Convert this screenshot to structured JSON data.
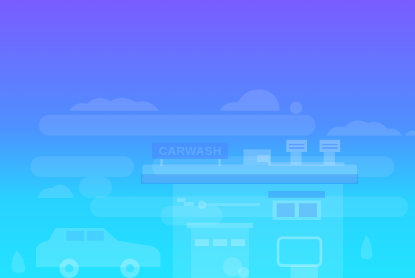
{
  "scene": {
    "sign_text": "CARWASH",
    "icons": [
      "cloud-icon",
      "carwash-building-icon",
      "car-icon",
      "water-drop-icon",
      "vending-machine-icon"
    ]
  },
  "colors": {
    "gradient_top": "#7a5cff",
    "gradient_mid": "#4aa3ff",
    "gradient_bottom": "#22e0ff",
    "silhouette": "#ffffff",
    "sign_background": "#4a86ff",
    "sign_text": "#5fa8ff"
  }
}
